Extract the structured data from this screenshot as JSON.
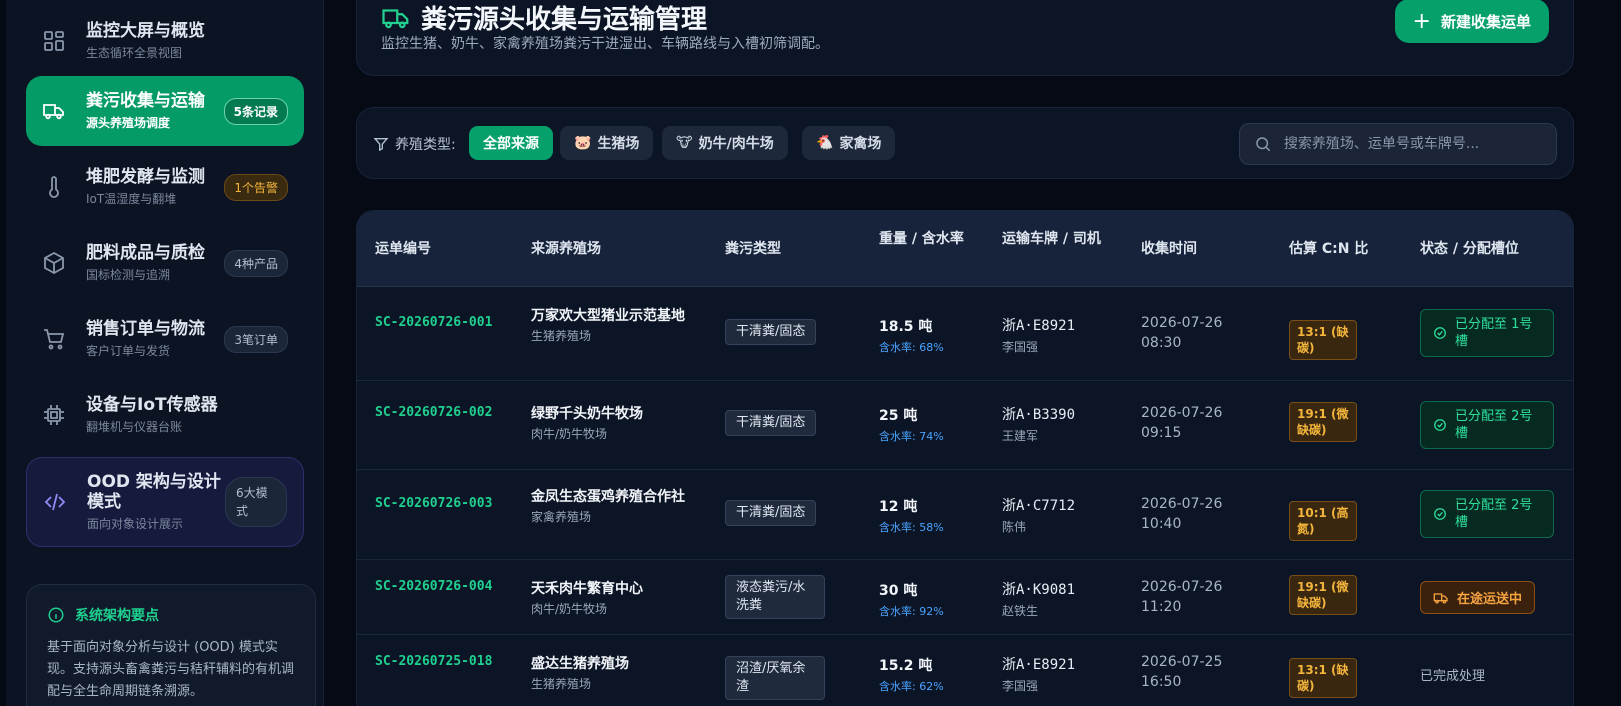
{
  "sidebar": {
    "items": [
      {
        "title": "监控大屏与概览",
        "sub": "生态循环全景视图",
        "badge": ""
      },
      {
        "title": "粪污收集与运输",
        "sub": "源头养殖场调度",
        "badge": "5条记录"
      },
      {
        "title": "堆肥发酵与监测",
        "sub": "IoT温湿度与翻堆",
        "badge": "1个告警"
      },
      {
        "title": "肥料成品与质检",
        "sub": "国标检测与追溯",
        "badge": "4种产品"
      },
      {
        "title": "销售订单与物流",
        "sub": "客户订单与发货",
        "badge": "3笔订单"
      },
      {
        "title": "设备与IoT传感器",
        "sub": "翻堆机与仪器台账",
        "badge": ""
      },
      {
        "title": "OOD 架构与设计模式",
        "sub": "面向对象设计展示",
        "badge": "6大模式"
      }
    ],
    "info": {
      "title": "系统架构要点",
      "body": "基于面向对象分析与设计 (OOD) 模式实现。支持源头畜禽粪污与秸秆辅料的有机调配与全生命周期链条溯源。"
    }
  },
  "header": {
    "title": "粪污源头收集与运输管理",
    "subtitle": "监控生猪、奶牛、家禽养殖场粪污干进湿出、车辆路线与入槽初筛调配。",
    "new_button": "新建收集运单"
  },
  "filter": {
    "label": "养殖类型:",
    "chips": [
      {
        "label": "全部来源",
        "emoji": ""
      },
      {
        "label": "生猪场",
        "emoji": "🐷"
      },
      {
        "label": "奶牛/肉牛场",
        "emoji": "🐮"
      },
      {
        "label": "家禽场",
        "emoji": "🐔"
      }
    ],
    "search_placeholder": "搜索养殖场、运单号或车牌号..."
  },
  "table": {
    "columns": [
      "运单编号",
      "来源养殖场",
      "粪污类型",
      "重量 / 含水率",
      "运输车牌 / 司机",
      "收集时间",
      "估算 C:N 比",
      "状态 / 分配槽位"
    ],
    "rows": [
      {
        "id": "SC-20260726-001",
        "farm": "万家欢大型猪业示范基地",
        "farm_type": "生猪养殖场",
        "waste": "干清粪/固态",
        "weight": "18.5 吨",
        "water": "含水率: 68%",
        "plate": "浙A·E8921",
        "driver": "李国强",
        "time": "2026-07-26 08:30",
        "cn": "13:1 (缺碳)",
        "status": "已分配至 1号槽",
        "status_kind": "ok"
      },
      {
        "id": "SC-20260726-002",
        "farm": "绿野千头奶牛牧场",
        "farm_type": "肉牛/奶牛牧场",
        "waste": "干清粪/固态",
        "weight": "25 吨",
        "water": "含水率: 74%",
        "plate": "浙A·B3390",
        "driver": "王建军",
        "time": "2026-07-26 09:15",
        "cn": "19:1 (微缺碳)",
        "status": "已分配至 2号槽",
        "status_kind": "ok"
      },
      {
        "id": "SC-20260726-003",
        "farm": "金凤生态蛋鸡养殖合作社",
        "farm_type": "家禽养殖场",
        "waste": "干清粪/固态",
        "weight": "12 吨",
        "water": "含水率: 58%",
        "plate": "浙A·C7712",
        "driver": "陈伟",
        "time": "2026-07-26 10:40",
        "cn": "10:1 (高氮)",
        "status": "已分配至 2号槽",
        "status_kind": "ok"
      },
      {
        "id": "SC-20260726-004",
        "farm": "天禾肉牛繁育中心",
        "farm_type": "肉牛/奶牛牧场",
        "waste": "液态粪污/水洗粪",
        "weight": "30 吨",
        "water": "含水率: 92%",
        "plate": "浙A·K9081",
        "driver": "赵铁生",
        "time": "2026-07-26 11:20",
        "cn": "19:1 (微缺碳)",
        "status": "在途运送中",
        "status_kind": "transit"
      },
      {
        "id": "SC-20260725-018",
        "farm": "盛达生猪养殖场",
        "farm_type": "生猪养殖场",
        "waste": "沼渣/厌氧余渣",
        "weight": "15.2 吨",
        "water": "含水率: 62%",
        "plate": "浙A·E8921",
        "driver": "李国强",
        "time": "2026-07-25 16:50",
        "cn": "13:1 (缺碳)",
        "status": "已完成处理",
        "status_kind": "done"
      }
    ]
  },
  "colors": {
    "accent": "#06a06b",
    "accent_text": "#1fd08f",
    "warn": "#f3b53b",
    "info": "#4aa3ff",
    "bg": "#050a14"
  }
}
